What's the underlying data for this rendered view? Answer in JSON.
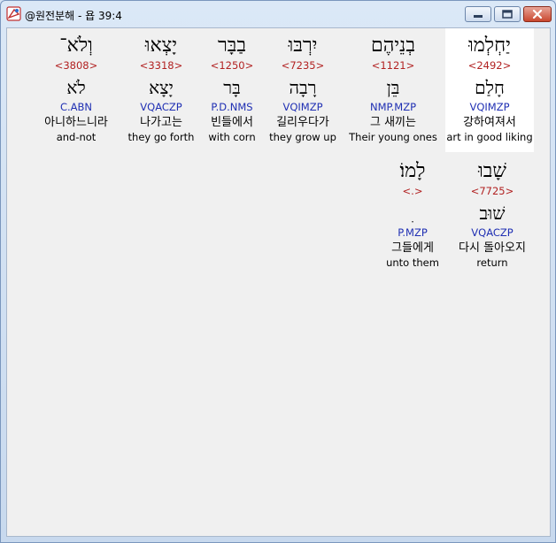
{
  "window": {
    "title": "@원전분해 - 욥 39:4",
    "buttons": {
      "minimize": "minimize-icon",
      "maximize": "maximize-icon",
      "close": "close-icon"
    }
  },
  "words": [
    {
      "hebrew": "יַחְלְמוּ",
      "strong": "<2492>",
      "lemma": "חָלַם",
      "morph": "VQIMZP",
      "korean": "강하여져서",
      "english": "art in good liking",
      "highlighted": true
    },
    {
      "hebrew": "בְנֵיהֶם",
      "strong": "<1121>",
      "lemma": "בֵּן",
      "morph": "NMP.MZP",
      "korean": "그 새끼는",
      "english": "Their young ones",
      "highlighted": false
    },
    {
      "hebrew": "יִרְבּוּ",
      "strong": "<7235>",
      "lemma": "רָבָה",
      "morph": "VQIMZP",
      "korean": "길리우다가",
      "english": "they grow up",
      "highlighted": false
    },
    {
      "hebrew": "בַבָּר",
      "strong": "<1250>",
      "lemma": "בָּר",
      "morph": "P.D.NMS",
      "korean": "빈들에서",
      "english": "with corn",
      "highlighted": false
    },
    {
      "hebrew": "יָצְאוּ",
      "strong": "<3318>",
      "lemma": "יָצָא",
      "morph": "VQACZP",
      "korean": "나가고는",
      "english": "they go forth",
      "highlighted": false
    },
    {
      "hebrew": "וְלֹא־",
      "strong": "<3808>",
      "lemma": "לֹא",
      "morph": "C.ABN",
      "korean": "아니하느니라",
      "english": "and-not",
      "highlighted": false
    },
    {
      "hebrew": "שָׁבוּ",
      "strong": "<7725>",
      "lemma": "שׁוּב",
      "morph": "VQACZP",
      "korean": "다시 돌아오지",
      "english": "return",
      "highlighted": false
    },
    {
      "hebrew": "לָמוֹ׃",
      "strong": "<.>",
      "lemma": "ִ",
      "morph": "P.MZP",
      "korean": "그들에게",
      "english": "unto them",
      "highlighted": false
    }
  ],
  "colors": {
    "strong": "#b22222",
    "morph": "#1f2fb3",
    "highlight": "#ffffff",
    "background": "#f0f0f0"
  }
}
